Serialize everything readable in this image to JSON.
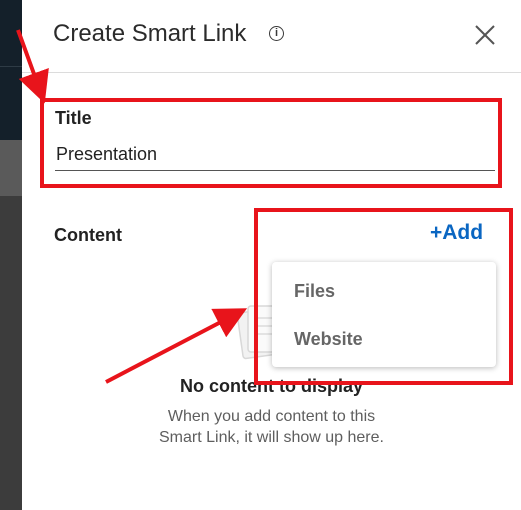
{
  "dialog": {
    "title": "Create Smart Link",
    "info_icon": "info-icon",
    "close_icon": "close-icon"
  },
  "title_field": {
    "label": "Title",
    "value": "Presentation"
  },
  "content": {
    "label": "Content",
    "add_label": "+Add",
    "menu": {
      "items": [
        {
          "label": "Files"
        },
        {
          "label": "Website"
        }
      ]
    },
    "empty_state": {
      "title": "No content to display",
      "description_line1": "When you add content to this",
      "description_line2": "Smart Link, it will show up here."
    }
  },
  "colors": {
    "accent": "#0a66c2",
    "annotation": "#e8141b"
  }
}
